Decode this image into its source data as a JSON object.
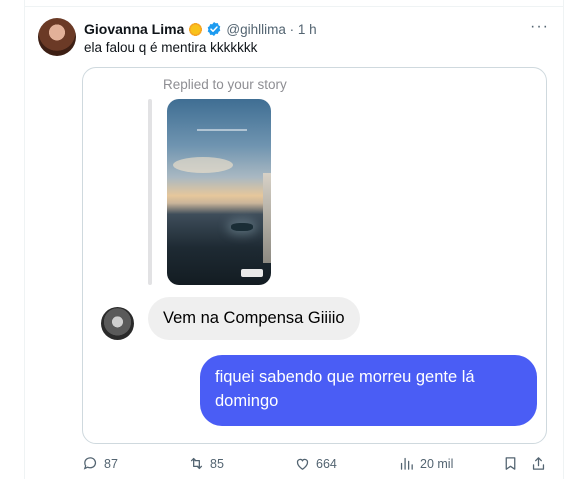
{
  "tweet": {
    "author_name": "Giovanna Lima",
    "handle_time": "@gihllima · 1 h",
    "text": "ela falou q é mentira kkkkkkk",
    "more_label": "···"
  },
  "dm": {
    "replied_label": "Replied to your story",
    "incoming_message": "Vem na Compensa Giiiio",
    "outgoing_message": "fiquei sabendo que morreu gente lá domingo"
  },
  "actions": {
    "replies": "87",
    "retweets": "85",
    "likes": "664",
    "views": "20 mil"
  },
  "colors": {
    "outgoing_bubble": "#4a5df5",
    "incoming_bubble": "#efefef",
    "verified": "#1d9bf0"
  },
  "icons": [
    "sun-emoji-icon",
    "verified-badge-icon",
    "more-icon",
    "reply-icon",
    "retweet-icon",
    "like-icon",
    "views-icon",
    "bookmark-icon",
    "share-icon"
  ]
}
